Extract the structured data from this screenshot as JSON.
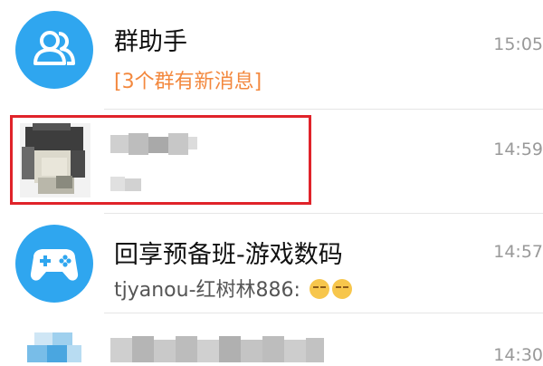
{
  "chats": [
    {
      "name": "群助手",
      "preview": "[3个群有新消息]",
      "time": "15:05",
      "avatar_icon": "group-contacts-icon",
      "avatar_color": "#2fa6ef"
    },
    {
      "name": "",
      "preview": "",
      "time": "14:59",
      "avatar_icon": "pixelated-photo-avatar",
      "highlighted": true,
      "highlight_color": "#e0232a"
    },
    {
      "name": "回享预备班-游戏数码",
      "preview": "tjyanou-红树林886: ",
      "preview_emoji": [
        "pensive-emoji",
        "pensive-emoji"
      ],
      "time": "14:57",
      "avatar_icon": "gamepad-icon",
      "avatar_color": "#2fa6ef"
    },
    {
      "name": "",
      "preview": "",
      "time": "14:30",
      "avatar_icon": "pixelated-avatar"
    }
  ],
  "colors": {
    "accent_orange": "#f3883e",
    "time_gray": "#999999"
  }
}
